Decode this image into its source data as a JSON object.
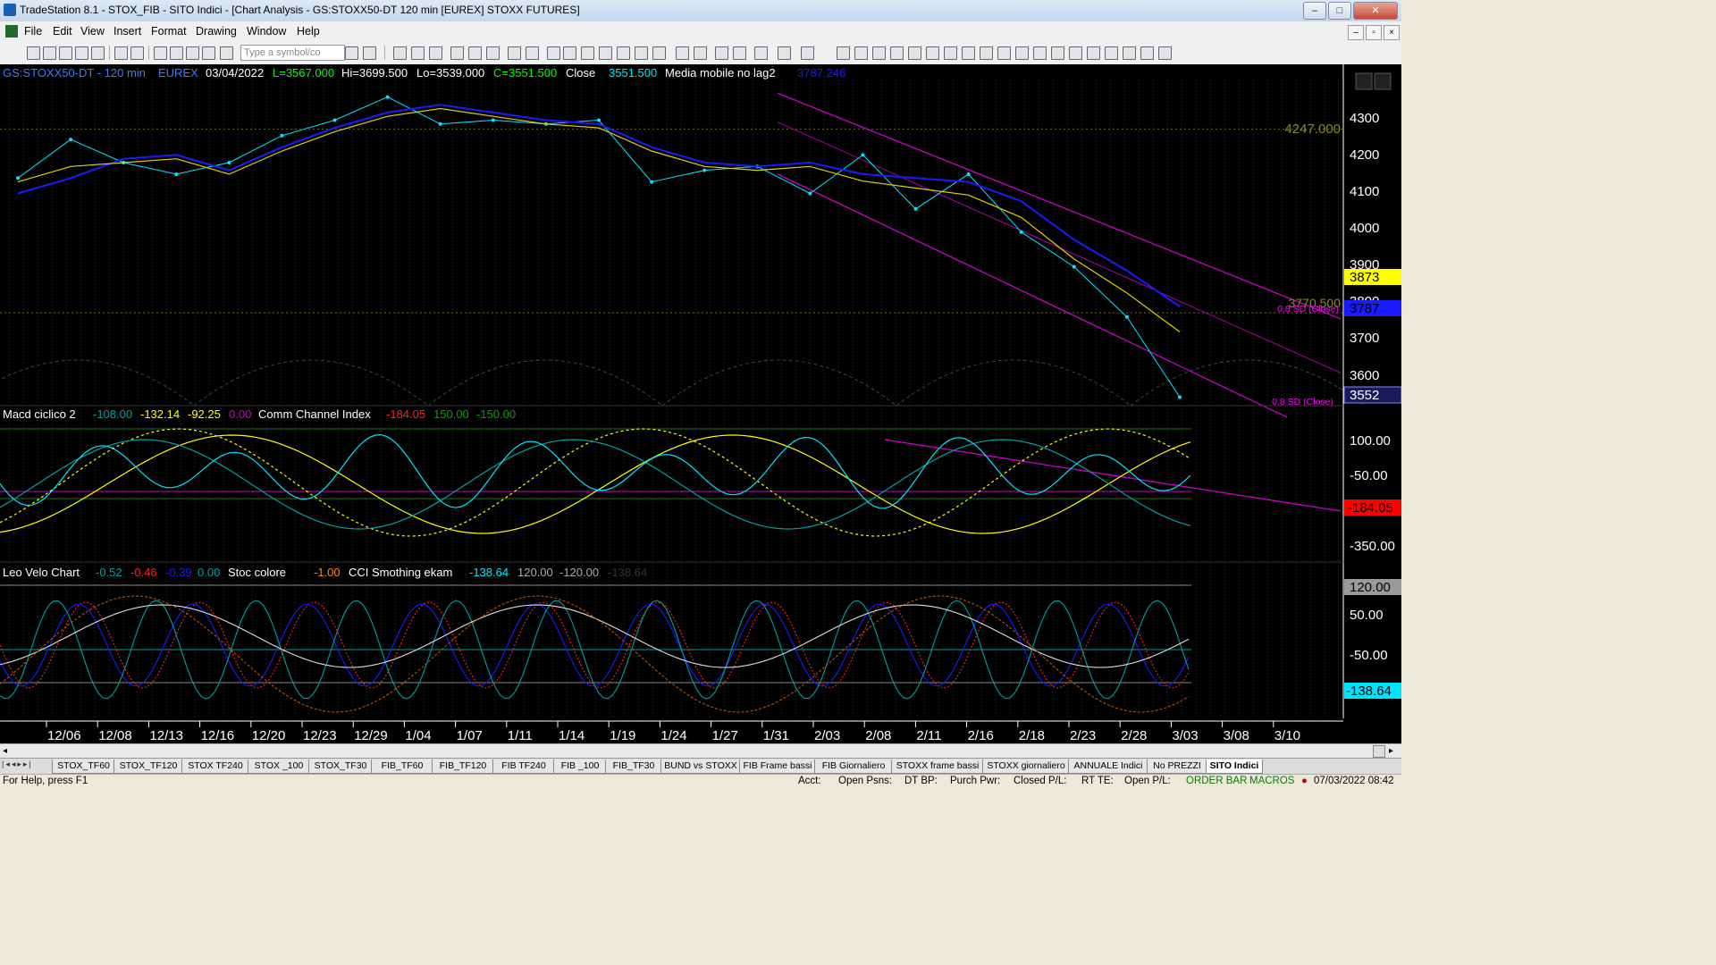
{
  "window": {
    "title": "TradeStation 8.1 - STOX_FIB - SITO Indici - [Chart Analysis - GS:STOXX50-DT  120 min  [EUREX] STOXX FUTURES]",
    "min_label": "–",
    "max_label": "□",
    "close_label": "✕"
  },
  "menu": [
    "File",
    "Edit",
    "View",
    "Insert",
    "Format",
    "Drawing",
    "Window",
    "Help"
  ],
  "mdi_buttons": [
    "–",
    "▫",
    "×"
  ],
  "toolbar": {
    "symbol_placeholder": "Type a symbol/co"
  },
  "panel1": {
    "symbol": "GS:STOXX50-DT - 120 min",
    "exchange": "EUREX",
    "date": "03/04/2022",
    "last": "L=3567.000",
    "high": "Hi=3699.500",
    "low": "Lo=3539.000",
    "close": "C=3551.500",
    "close_label": "Close",
    "close_value": "3551.500",
    "ma_label": "Media mobile no lag2",
    "ma_value": "3787.246",
    "level_label": "4247.000",
    "partial_level": "3770.500",
    "sd_label_upper": "0.8 SD (Close)",
    "sd_label_lower": "0.8 SD (Close)",
    "axis": [
      "4300",
      "4200",
      "4100",
      "4000",
      "3900",
      "3800",
      "3700",
      "3600"
    ],
    "tag_yellow": "3873",
    "tag_blue": "3787",
    "tag_price": "3552"
  },
  "panel2": {
    "name": "Macd ciclico 2",
    "v1": "-108.00",
    "v2": "-132.14",
    "v3": "-92.25",
    "v4": "0.00",
    "cci_name": "Comm Channel Index",
    "cci_v1": "-184.05",
    "cci_v2": "150.00",
    "cci_v3": "-150.00",
    "axis": [
      "100.00",
      "-50.00",
      "-350.00"
    ],
    "tag_red": "-184.05"
  },
  "panel3": {
    "name": "Leo Velo Chart",
    "v1": "-0.52",
    "v2": "-0.46",
    "v3": "-0.39",
    "v4": "0.00",
    "stoc_name": "Stoc colore",
    "stoc_v": "-1.00",
    "cci_name": "CCI Smothing ekam",
    "cci_v1": "-138.64",
    "cci_v2": "120.00",
    "cci_v3": "-120.00",
    "cci_v4": "-138.64",
    "axis": [
      "50.00",
      "-50.00"
    ],
    "tag_top": "120.00",
    "tag_bottom": "-138.64"
  },
  "dates": [
    "12/06",
    "12/08",
    "12/13",
    "12/16",
    "12/20",
    "12/23",
    "12/29",
    "1/04",
    "1/07",
    "1/11",
    "1/14",
    "1/19",
    "1/24",
    "1/27",
    "1/31",
    "2/03",
    "2/08",
    "2/11",
    "2/16",
    "2/18",
    "2/23",
    "2/28",
    "3/03",
    "3/08",
    "3/10"
  ],
  "tabs": [
    "STOX_TF60",
    "STOX_TF120",
    "STOX TF240",
    "STOX _100",
    "STOX_TF30",
    "FIB_TF60",
    "FIB_TF120",
    "FIB TF240",
    "FIB _100",
    "FIB_TF30",
    "BUND vs STOXX",
    "FIB Frame bassi",
    "FIB Giornaliero",
    "STOXX frame bassi",
    "STOXX giornaliero",
    "ANNUALE Indici",
    "No PREZZI",
    "SITO Indici"
  ],
  "status": {
    "help": "For Help, press F1",
    "acct": "Acct:",
    "open_psns": "Open Psns:",
    "dt_bp": "DT BP:",
    "purch_pwr": "Purch Pwr:",
    "closed_pl": "Closed P/L:",
    "rt_te": "RT TE:",
    "open_pl": "Open P/L:",
    "order_bar": "ORDER BAR",
    "macros": "MACROS",
    "datetime": "07/03/2022 08:42"
  },
  "colors": {
    "chart_bg": "#000000",
    "price_dots": "#00e5ff",
    "ma_blue": "#1a1aff",
    "ma_yellow": "#e0d000",
    "channel": "#cc00cc",
    "axis_text": "#ffffff"
  },
  "chart_data": {
    "type": "line",
    "title": "GS:STOXX50-DT - 120 min",
    "x": [
      "12/06",
      "12/08",
      "12/13",
      "12/16",
      "12/20",
      "12/23",
      "12/29",
      "1/04",
      "1/07",
      "1/11",
      "1/14",
      "1/19",
      "1/24",
      "1/27",
      "1/31",
      "2/03",
      "2/08",
      "2/11",
      "2/16",
      "2/18",
      "2/23",
      "2/28",
      "3/03"
    ],
    "series": [
      {
        "name": "Close",
        "values": [
          4120,
          4220,
          4160,
          4130,
          4160,
          4230,
          4270,
          4330,
          4260,
          4270,
          4260,
          4270,
          4110,
          4140,
          4150,
          4080,
          4180,
          4040,
          4130,
          3980,
          3890,
          3760,
          3552
        ]
      },
      {
        "name": "Media mobile no lag2",
        "values": [
          4080,
          4120,
          4170,
          4180,
          4140,
          4200,
          4250,
          4290,
          4310,
          4290,
          4270,
          4260,
          4200,
          4160,
          4150,
          4160,
          4130,
          4120,
          4110,
          4060,
          3960,
          3880,
          3787
        ]
      }
    ],
    "ylim": [
      3530,
      4380
    ]
  }
}
